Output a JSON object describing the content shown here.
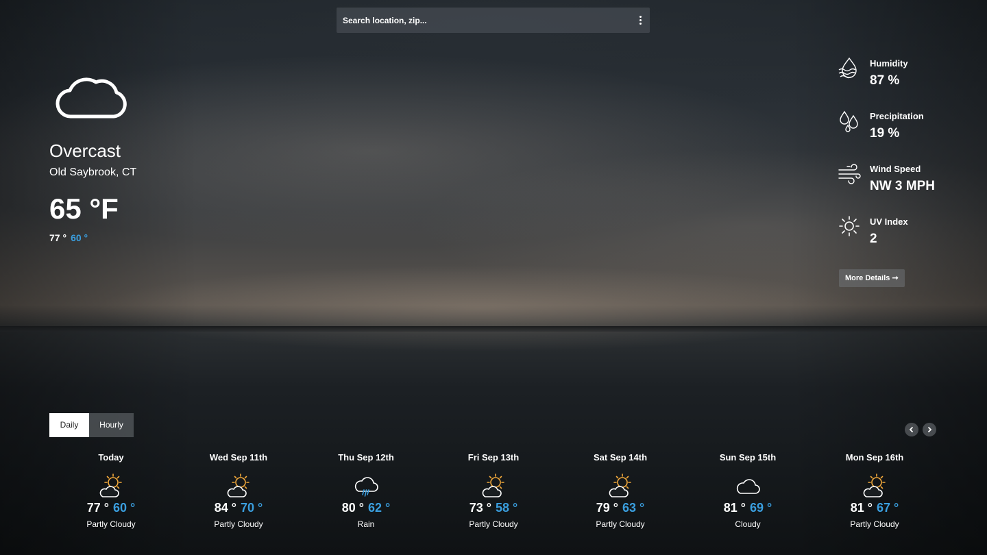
{
  "search": {
    "placeholder": "Search location, zip..."
  },
  "current": {
    "condition": "Overcast",
    "location": "Old Saybrook, CT",
    "temperature": "65 °F",
    "high": "77 °",
    "low": "60 °",
    "icon": "cloud-icon"
  },
  "stats": [
    {
      "label": "Humidity",
      "value": "87 %",
      "icon": "humidity-icon"
    },
    {
      "label": "Precipitation",
      "value": "19 %",
      "icon": "droplets-icon"
    },
    {
      "label": "Wind Speed",
      "value": "NW 3 MPH",
      "icon": "wind-icon"
    },
    {
      "label": "UV Index",
      "value": "2",
      "icon": "sun-icon"
    }
  ],
  "more_details_label": "More Details",
  "tabs": [
    {
      "label": "Daily",
      "active": true
    },
    {
      "label": "Hourly",
      "active": false
    }
  ],
  "forecast": [
    {
      "day": "Today",
      "high": "77 °",
      "low": "60 °",
      "condition": "Partly Cloudy",
      "icon": "partly-cloudy-icon"
    },
    {
      "day": "Wed Sep 11th",
      "high": "84 °",
      "low": "70 °",
      "condition": "Partly Cloudy",
      "icon": "partly-cloudy-icon"
    },
    {
      "day": "Thu Sep 12th",
      "high": "80 °",
      "low": "62 °",
      "condition": "Rain",
      "icon": "rain-icon"
    },
    {
      "day": "Fri Sep 13th",
      "high": "73 °",
      "low": "58 °",
      "condition": "Partly Cloudy",
      "icon": "partly-cloudy-icon"
    },
    {
      "day": "Sat Sep 14th",
      "high": "79 °",
      "low": "63 °",
      "condition": "Partly Cloudy",
      "icon": "partly-cloudy-icon"
    },
    {
      "day": "Sun Sep 15th",
      "high": "81 °",
      "low": "69 °",
      "condition": "Cloudy",
      "icon": "cloud-icon"
    },
    {
      "day": "Mon Sep 16th",
      "high": "81 °",
      "low": "67 °",
      "condition": "Partly Cloudy",
      "icon": "partly-cloudy-icon"
    }
  ],
  "colors": {
    "low_temp": "#3a9ede",
    "sun": "#f2a93b"
  }
}
